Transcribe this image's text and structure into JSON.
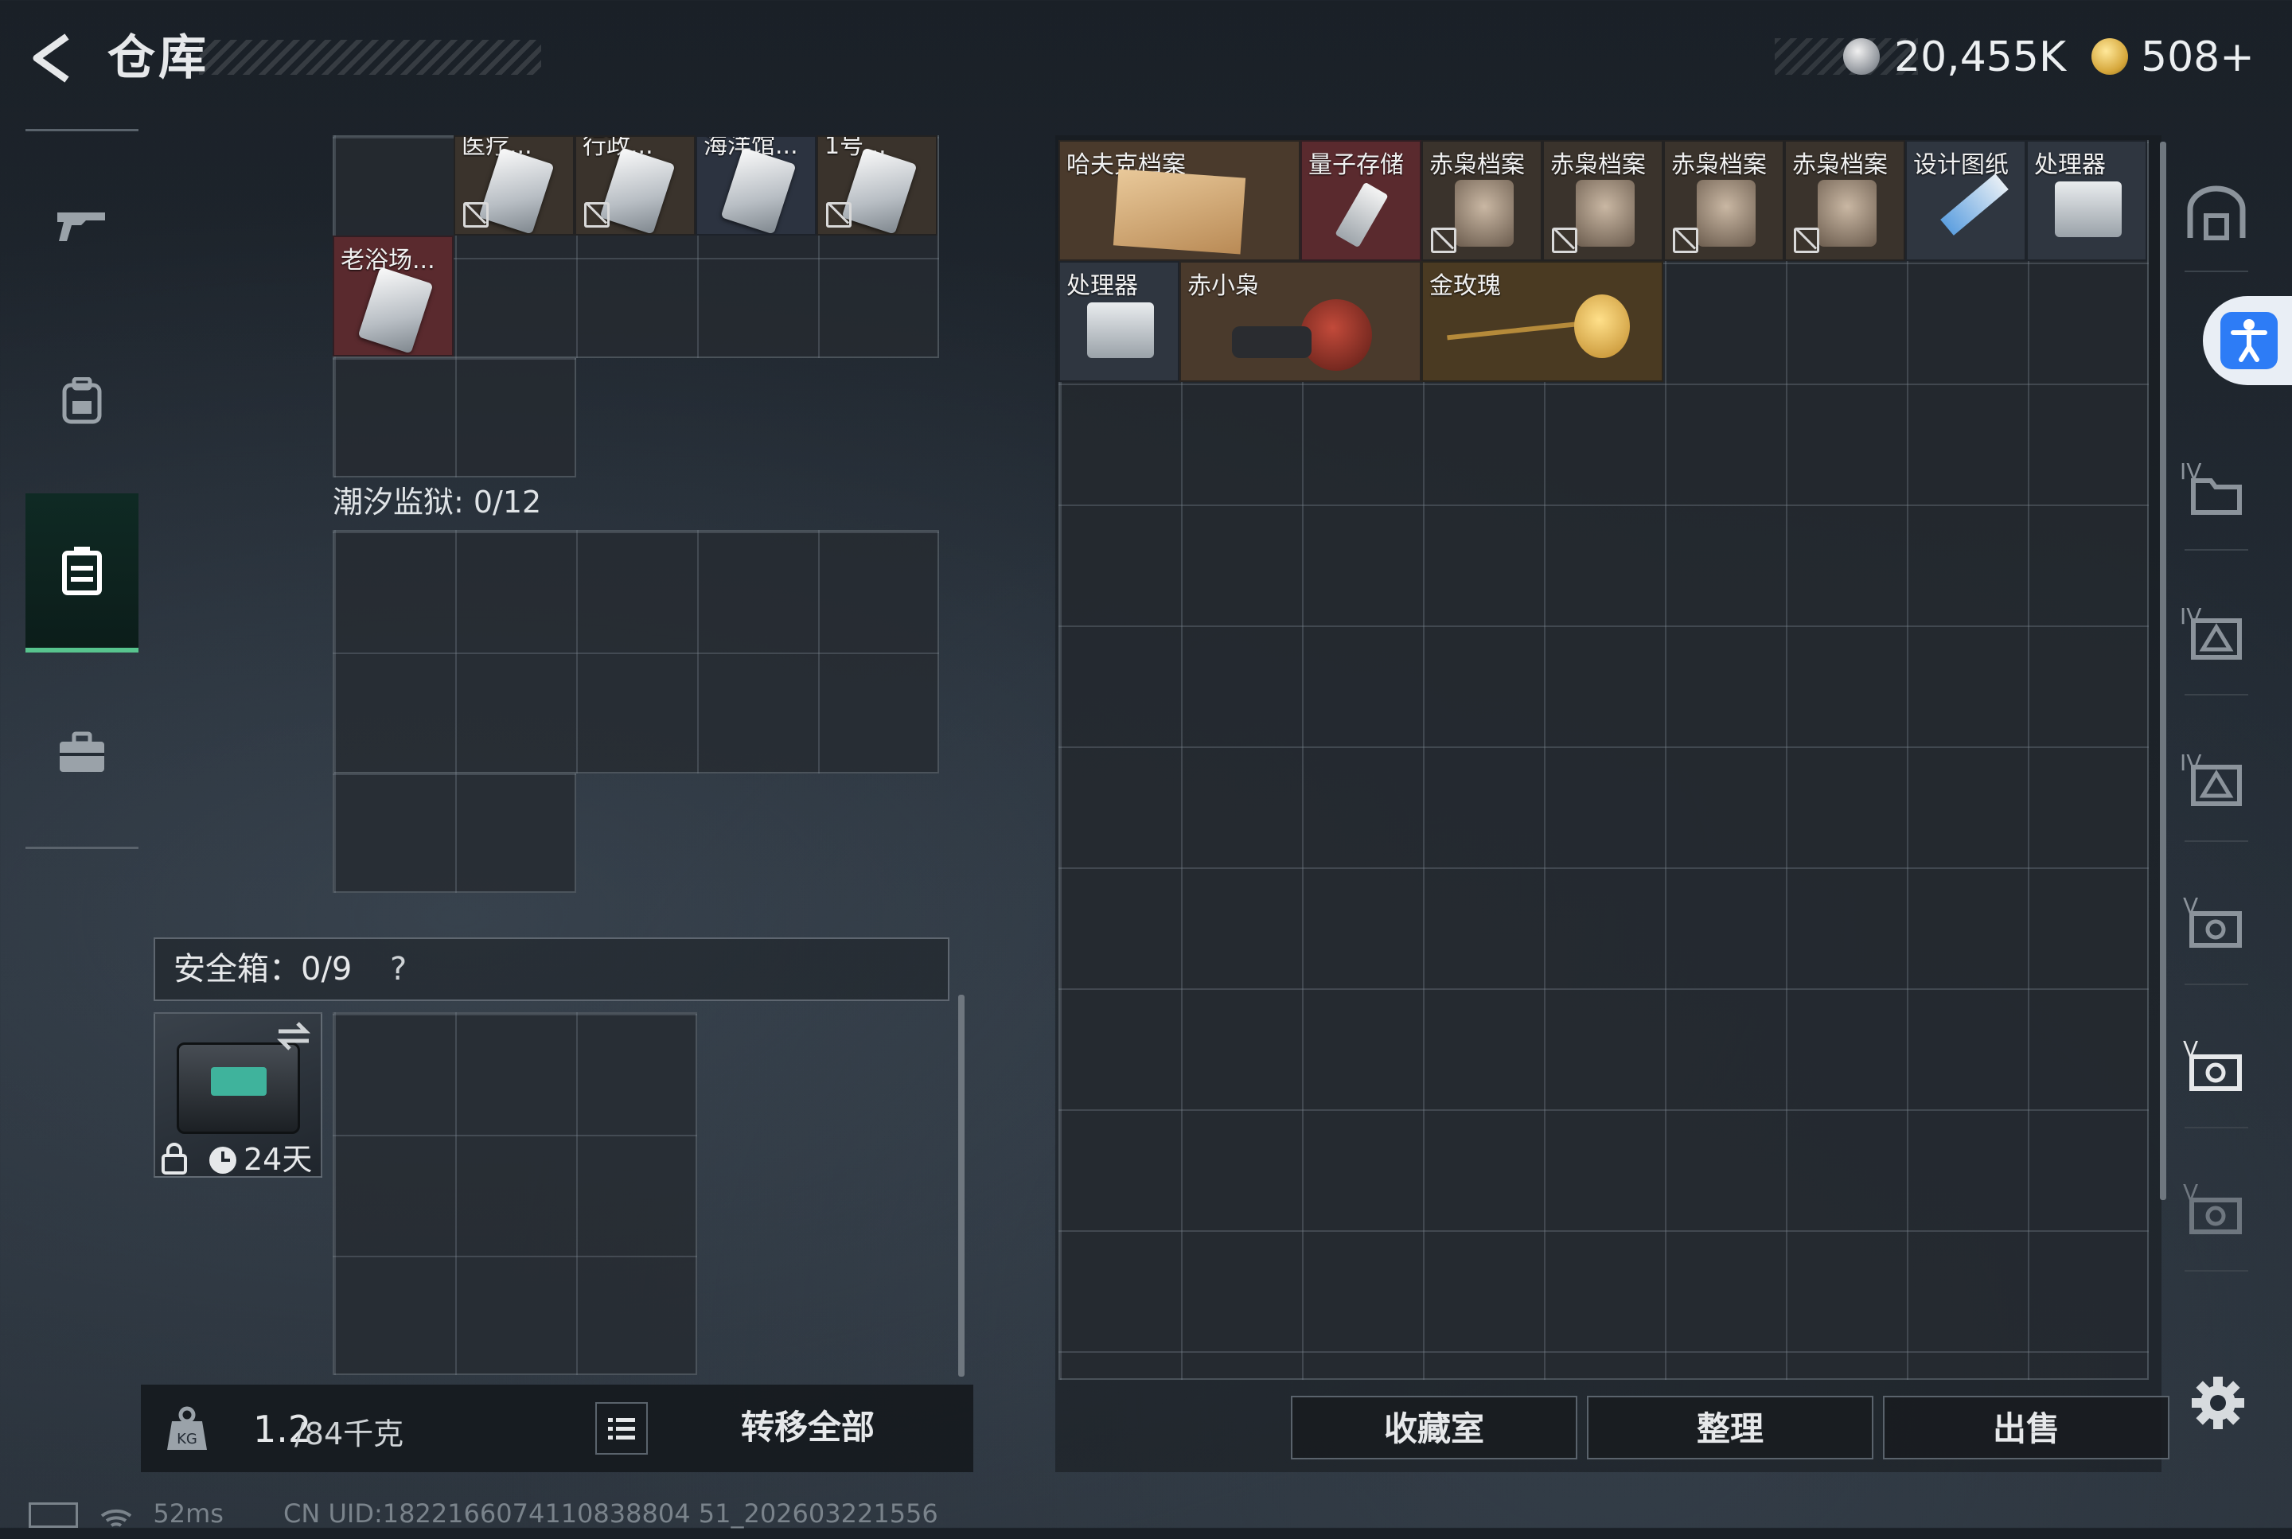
{
  "header": {
    "title": "仓库",
    "currency_coins": "20,455K",
    "currency_premium": "508+"
  },
  "left_items": {
    "row1": [
      {
        "label": "医疗..."
      },
      {
        "label": "行政..."
      },
      {
        "label": "海洋馆..."
      },
      {
        "label": "1号..."
      }
    ],
    "row2": [
      {
        "label": "老浴场..."
      }
    ]
  },
  "section": {
    "label": "潮汐监狱: 0/12"
  },
  "safebox": {
    "label": "安全箱：0/9",
    "help": "?",
    "days": "24天"
  },
  "bottom": {
    "weight_value": "1.2",
    "weight_max": "/84千克",
    "transfer_all": "转移全部"
  },
  "right_items": [
    {
      "label": "哈夫克档案",
      "bound": false
    },
    {
      "label": "量子存储",
      "bound": false
    },
    {
      "label": "赤枭档案",
      "bound": true
    },
    {
      "label": "赤枭档案",
      "bound": true
    },
    {
      "label": "赤枭档案",
      "bound": true
    },
    {
      "label": "赤枭档案",
      "bound": true
    },
    {
      "label": "设计图纸",
      "bound": false
    },
    {
      "label": "处理器",
      "bound": false
    },
    {
      "label": "处理器",
      "bound": false
    },
    {
      "label": "赤小枭",
      "bound": false
    },
    {
      "label": "金玫瑰",
      "bound": false
    }
  ],
  "right_buttons": {
    "collection": "收藏室",
    "sort": "整理",
    "sell": "出售"
  },
  "rail": {
    "tier4": "IV",
    "tier5": "V"
  },
  "status": {
    "ping": "52ms",
    "uid": "CN UID:1822166074110838804 51_202603221556"
  },
  "colors": {
    "accent_green": "#58c48e",
    "bound_cell": "#5a2a2e",
    "gold_cell": "#4a3a22"
  }
}
